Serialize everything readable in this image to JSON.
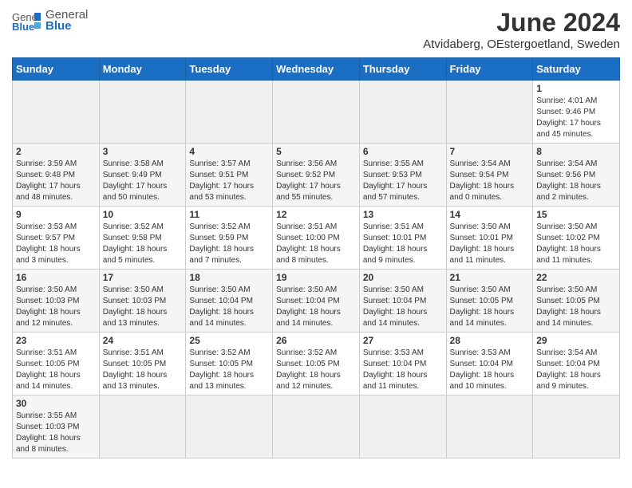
{
  "header": {
    "logo_general": "General",
    "logo_blue": "Blue",
    "title": "June 2024",
    "subtitle": "Atvidaberg, OEstergoetland, Sweden"
  },
  "weekdays": [
    "Sunday",
    "Monday",
    "Tuesday",
    "Wednesday",
    "Thursday",
    "Friday",
    "Saturday"
  ],
  "weeks": [
    [
      {
        "day": "",
        "info": ""
      },
      {
        "day": "",
        "info": ""
      },
      {
        "day": "",
        "info": ""
      },
      {
        "day": "",
        "info": ""
      },
      {
        "day": "",
        "info": ""
      },
      {
        "day": "",
        "info": ""
      },
      {
        "day": "1",
        "info": "Sunrise: 4:01 AM\nSunset: 9:46 PM\nDaylight: 17 hours\nand 45 minutes."
      }
    ],
    [
      {
        "day": "2",
        "info": "Sunrise: 3:59 AM\nSunset: 9:48 PM\nDaylight: 17 hours\nand 48 minutes."
      },
      {
        "day": "3",
        "info": "Sunrise: 3:58 AM\nSunset: 9:49 PM\nDaylight: 17 hours\nand 50 minutes."
      },
      {
        "day": "4",
        "info": "Sunrise: 3:57 AM\nSunset: 9:51 PM\nDaylight: 17 hours\nand 53 minutes."
      },
      {
        "day": "5",
        "info": "Sunrise: 3:56 AM\nSunset: 9:52 PM\nDaylight: 17 hours\nand 55 minutes."
      },
      {
        "day": "6",
        "info": "Sunrise: 3:55 AM\nSunset: 9:53 PM\nDaylight: 17 hours\nand 57 minutes."
      },
      {
        "day": "7",
        "info": "Sunrise: 3:54 AM\nSunset: 9:54 PM\nDaylight: 18 hours\nand 0 minutes."
      },
      {
        "day": "8",
        "info": "Sunrise: 3:54 AM\nSunset: 9:56 PM\nDaylight: 18 hours\nand 2 minutes."
      }
    ],
    [
      {
        "day": "9",
        "info": "Sunrise: 3:53 AM\nSunset: 9:57 PM\nDaylight: 18 hours\nand 3 minutes."
      },
      {
        "day": "10",
        "info": "Sunrise: 3:52 AM\nSunset: 9:58 PM\nDaylight: 18 hours\nand 5 minutes."
      },
      {
        "day": "11",
        "info": "Sunrise: 3:52 AM\nSunset: 9:59 PM\nDaylight: 18 hours\nand 7 minutes."
      },
      {
        "day": "12",
        "info": "Sunrise: 3:51 AM\nSunset: 10:00 PM\nDaylight: 18 hours\nand 8 minutes."
      },
      {
        "day": "13",
        "info": "Sunrise: 3:51 AM\nSunset: 10:01 PM\nDaylight: 18 hours\nand 9 minutes."
      },
      {
        "day": "14",
        "info": "Sunrise: 3:50 AM\nSunset: 10:01 PM\nDaylight: 18 hours\nand 11 minutes."
      },
      {
        "day": "15",
        "info": "Sunrise: 3:50 AM\nSunset: 10:02 PM\nDaylight: 18 hours\nand 11 minutes."
      }
    ],
    [
      {
        "day": "16",
        "info": "Sunrise: 3:50 AM\nSunset: 10:03 PM\nDaylight: 18 hours\nand 12 minutes."
      },
      {
        "day": "17",
        "info": "Sunrise: 3:50 AM\nSunset: 10:03 PM\nDaylight: 18 hours\nand 13 minutes."
      },
      {
        "day": "18",
        "info": "Sunrise: 3:50 AM\nSunset: 10:04 PM\nDaylight: 18 hours\nand 14 minutes."
      },
      {
        "day": "19",
        "info": "Sunrise: 3:50 AM\nSunset: 10:04 PM\nDaylight: 18 hours\nand 14 minutes."
      },
      {
        "day": "20",
        "info": "Sunrise: 3:50 AM\nSunset: 10:04 PM\nDaylight: 18 hours\nand 14 minutes."
      },
      {
        "day": "21",
        "info": "Sunrise: 3:50 AM\nSunset: 10:05 PM\nDaylight: 18 hours\nand 14 minutes."
      },
      {
        "day": "22",
        "info": "Sunrise: 3:50 AM\nSunset: 10:05 PM\nDaylight: 18 hours\nand 14 minutes."
      }
    ],
    [
      {
        "day": "23",
        "info": "Sunrise: 3:51 AM\nSunset: 10:05 PM\nDaylight: 18 hours\nand 14 minutes."
      },
      {
        "day": "24",
        "info": "Sunrise: 3:51 AM\nSunset: 10:05 PM\nDaylight: 18 hours\nand 13 minutes."
      },
      {
        "day": "25",
        "info": "Sunrise: 3:52 AM\nSunset: 10:05 PM\nDaylight: 18 hours\nand 13 minutes."
      },
      {
        "day": "26",
        "info": "Sunrise: 3:52 AM\nSunset: 10:05 PM\nDaylight: 18 hours\nand 12 minutes."
      },
      {
        "day": "27",
        "info": "Sunrise: 3:53 AM\nSunset: 10:04 PM\nDaylight: 18 hours\nand 11 minutes."
      },
      {
        "day": "28",
        "info": "Sunrise: 3:53 AM\nSunset: 10:04 PM\nDaylight: 18 hours\nand 10 minutes."
      },
      {
        "day": "29",
        "info": "Sunrise: 3:54 AM\nSunset: 10:04 PM\nDaylight: 18 hours\nand 9 minutes."
      }
    ],
    [
      {
        "day": "30",
        "info": "Sunrise: 3:55 AM\nSunset: 10:03 PM\nDaylight: 18 hours\nand 8 minutes."
      },
      {
        "day": "",
        "info": ""
      },
      {
        "day": "",
        "info": ""
      },
      {
        "day": "",
        "info": ""
      },
      {
        "day": "",
        "info": ""
      },
      {
        "day": "",
        "info": ""
      },
      {
        "day": "",
        "info": ""
      }
    ]
  ]
}
